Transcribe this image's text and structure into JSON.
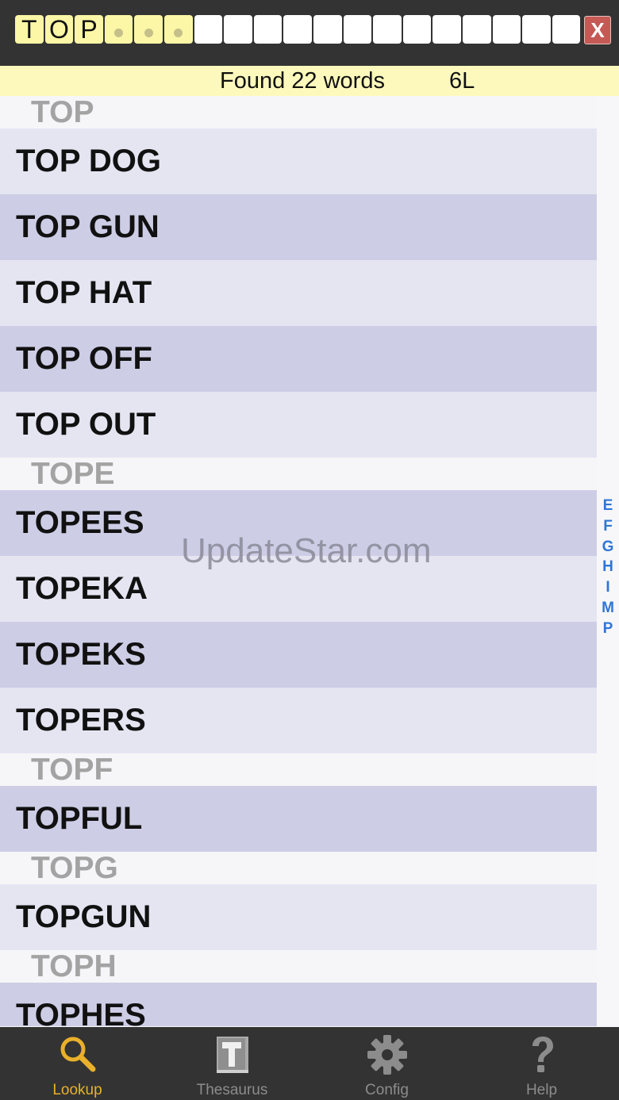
{
  "search": {
    "letters": [
      "T",
      "O",
      "P"
    ],
    "wildcards": 3,
    "empty_slots": 13,
    "clear_label": "X"
  },
  "status": {
    "found": "Found 22 words",
    "length": "6L"
  },
  "list": [
    {
      "kind": "section",
      "text": "TOP"
    },
    {
      "kind": "word",
      "text": "TOP DOG"
    },
    {
      "kind": "word",
      "text": "TOP GUN"
    },
    {
      "kind": "word",
      "text": "TOP HAT"
    },
    {
      "kind": "word",
      "text": "TOP OFF"
    },
    {
      "kind": "word",
      "text": "TOP OUT"
    },
    {
      "kind": "section",
      "text": "TOPE"
    },
    {
      "kind": "word",
      "text": "TOPEES"
    },
    {
      "kind": "word",
      "text": "TOPEKA"
    },
    {
      "kind": "word",
      "text": "TOPEKS"
    },
    {
      "kind": "word",
      "text": "TOPERS"
    },
    {
      "kind": "section",
      "text": "TOPF"
    },
    {
      "kind": "word",
      "text": "TOPFUL"
    },
    {
      "kind": "section",
      "text": "TOPG"
    },
    {
      "kind": "word",
      "text": "TOPGUN"
    },
    {
      "kind": "section",
      "text": "TOPH"
    },
    {
      "kind": "word",
      "text": "TOPHES"
    }
  ],
  "index": [
    "E",
    "F",
    "G",
    "H",
    "I",
    "M",
    "P"
  ],
  "watermark": "UpdateStar.com",
  "tabs": [
    {
      "label": "Lookup",
      "icon": "magnifier-icon",
      "active": true
    },
    {
      "label": "Thesaurus",
      "icon": "book-t-icon",
      "active": false
    },
    {
      "label": "Config",
      "icon": "gear-icon",
      "active": false
    },
    {
      "label": "Help",
      "icon": "question-icon",
      "active": false
    }
  ],
  "colors": {
    "bar": "#333333",
    "tile_filled": "#fcf7a6",
    "status_bg": "#fdf9bd",
    "row_light": "#e5e5f2",
    "row_dark": "#cdcde6",
    "accent": "#e9b02b",
    "index": "#2f76d6",
    "clear": "#c55a55"
  }
}
